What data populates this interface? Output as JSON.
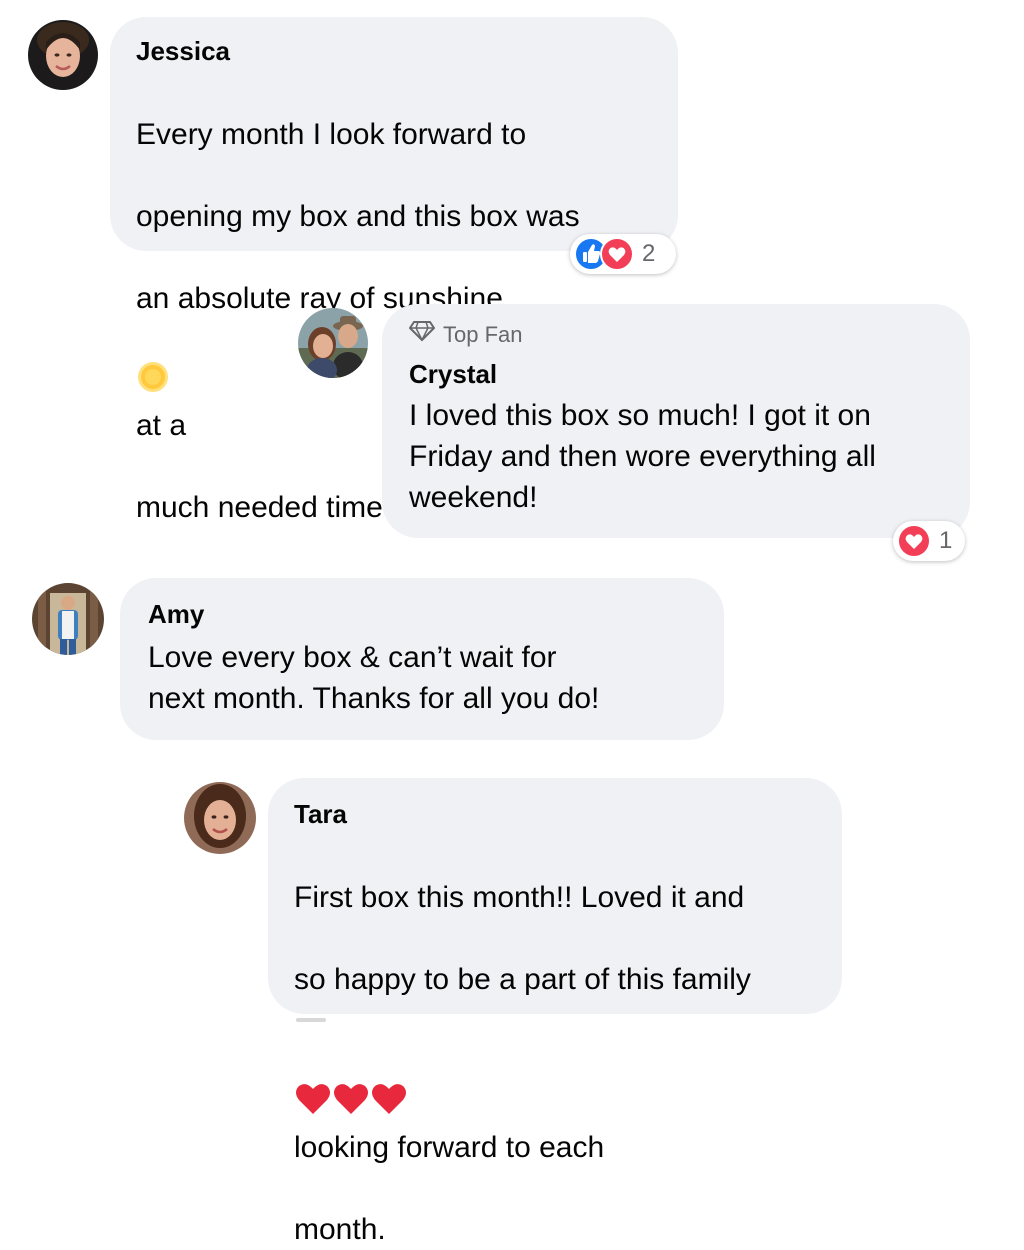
{
  "comments": [
    {
      "author": "Jessica",
      "lines": [
        "Every month I look forward to",
        "opening my box and this box was",
        "an absolute ray of sunshine",
        "at a",
        "much needed time"
      ],
      "inline_emoji": "sun-icon",
      "reactions": {
        "icons": [
          "like-icon",
          "love-icon"
        ],
        "count": "2"
      }
    },
    {
      "badge": "Top Fan",
      "badge_icon": "diamond-icon",
      "author": "Crystal",
      "text": "I loved this box so much! I got it on\nFriday and then wore everything all\nweekend!",
      "reactions": {
        "icons": [
          "love-icon"
        ],
        "count": "1"
      }
    },
    {
      "author": "Amy",
      "text": "Love every box & can’t wait for\nnext month. Thanks for all you do!"
    },
    {
      "author": "Tara",
      "line1": "First box this month!! Loved it and",
      "line2": "so happy to be a part of this family",
      "line3": "looking forward to each",
      "line4": "month.",
      "inline_emojis": [
        "red-heart-icon",
        "red-heart-icon",
        "red-heart-icon"
      ]
    }
  ],
  "colors": {
    "bubble": "#eff1f5",
    "like": "#1877f2",
    "love": "#f33e58",
    "meta_text": "#65676b"
  }
}
